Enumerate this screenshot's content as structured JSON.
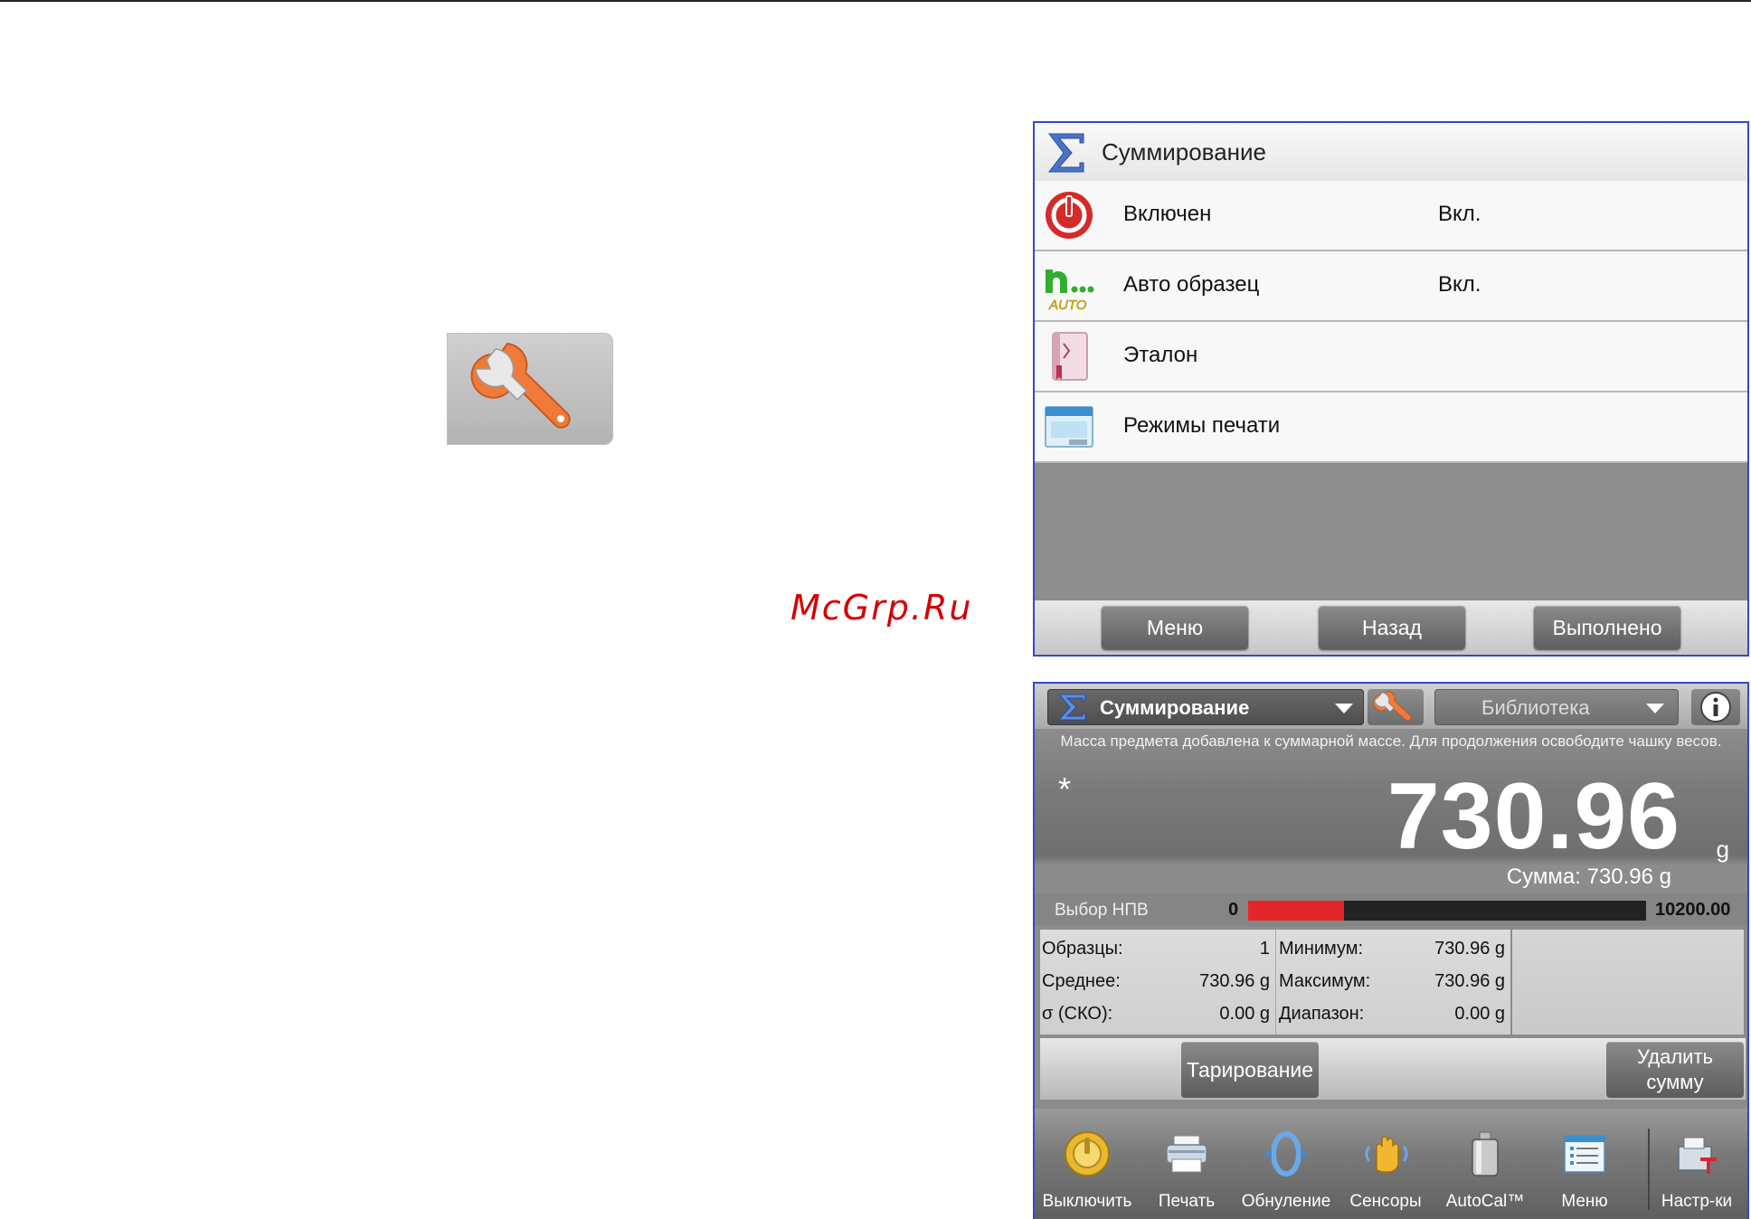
{
  "watermark": "McGrp.Ru",
  "summation_menu": {
    "title": "Суммирование",
    "items": [
      {
        "label": "Включен",
        "value": "Вкл.",
        "icon": "power-icon"
      },
      {
        "label": "Авто образец",
        "value": "Вкл.",
        "icon": "auto-sample-icon"
      },
      {
        "label": "Эталон",
        "value": "",
        "icon": "reference-book-icon"
      },
      {
        "label": "Режимы печати",
        "value": "",
        "icon": "print-mode-icon"
      }
    ],
    "buttons": {
      "menu": "Меню",
      "back": "Назад",
      "done": "Выполнено"
    }
  },
  "scale_screen": {
    "mode_dropdown": "Суммирование",
    "library_dropdown": "Библиотека",
    "message": "Масса предмета добавлена к суммарной массе.  Для продолжения освободите чашку весов.",
    "stable_marker": "*",
    "weight": "730.96",
    "unit": "g",
    "total": "Сумма: 730.96 g",
    "capacity": {
      "label": "Выбор НПВ",
      "min": "0",
      "max": "10200.00",
      "fill_fraction": 0.24
    },
    "stats": [
      {
        "label": "Образцы:",
        "value": "1"
      },
      {
        "label": "Среднее:",
        "value": "730.96 g"
      },
      {
        "label": "σ (СКО):",
        "value": "0.00 g"
      },
      {
        "label": "Минимум:",
        "value": "730.96 g"
      },
      {
        "label": "Максимум:",
        "value": "730.96 g"
      },
      {
        "label": "Диапазон:",
        "value": "0.00 g"
      }
    ],
    "tare_button": "Тарирование",
    "clear_total_line1": "Удалить",
    "clear_total_line2": "сумму",
    "toolbar": [
      {
        "label": "Выключить",
        "icon": "power-off-icon"
      },
      {
        "label": "Печать",
        "icon": "printer-icon"
      },
      {
        "label": "Обнуление",
        "icon": "zero-icon"
      },
      {
        "label": "Сенсоры",
        "icon": "sensor-hand-icon"
      },
      {
        "label": "AutoCal™",
        "icon": "calibration-weight-icon"
      },
      {
        "label": "Меню",
        "icon": "menu-icon"
      },
      {
        "label": "Настр-ки",
        "icon": "settings-icon"
      }
    ]
  },
  "colors": {
    "accent_border": "#3b45c8",
    "capacity_fill": "#e4262b",
    "wrench_orange": "#f07a3a"
  }
}
